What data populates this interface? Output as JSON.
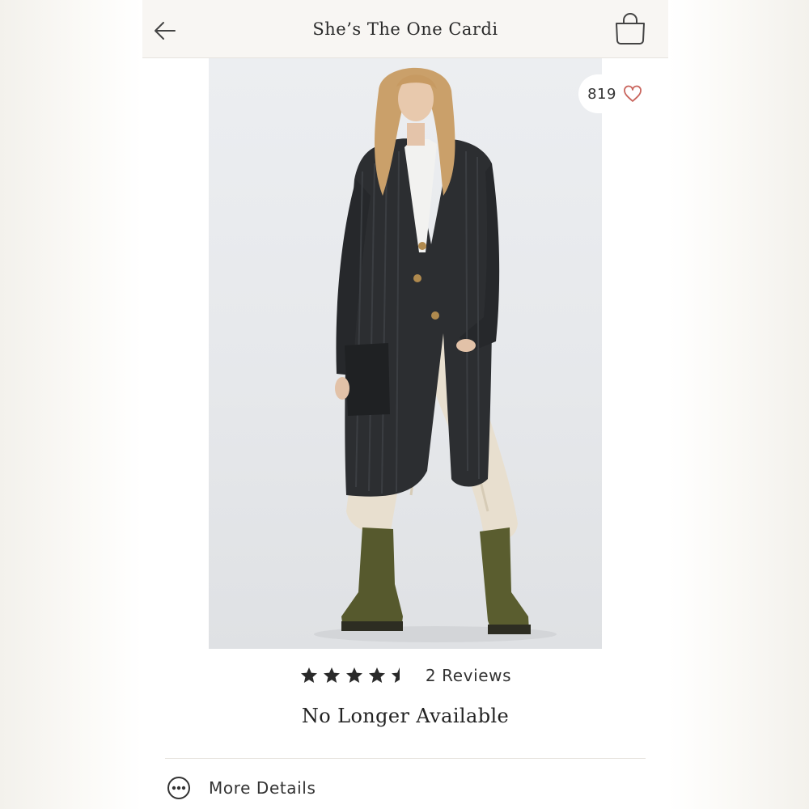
{
  "header": {
    "title": "She’s The One Cardi",
    "back_icon": "arrow-left-icon",
    "bag_icon": "shopping-bag-icon"
  },
  "product": {
    "image_alt": "Model wearing long black ribbed cardigan with cream pants and olive boots",
    "likes": "819",
    "like_icon": "heart-outline-icon",
    "rating": 4.5,
    "rating_max": 5,
    "reviews_label": "2 Reviews",
    "availability": "No Longer Available"
  },
  "details": {
    "label": "More Details",
    "icon": "more-dots-icon"
  },
  "colors": {
    "heart": "#c9655d",
    "text": "#222222",
    "topbar_bg": "#f8f6f3"
  }
}
